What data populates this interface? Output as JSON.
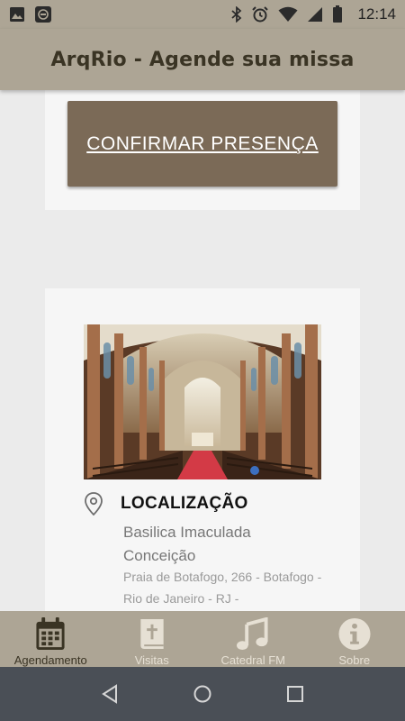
{
  "status_bar": {
    "time": "12:14",
    "icons": [
      "image-icon",
      "notification-app-icon",
      "bluetooth-icon",
      "alarm-icon",
      "wifi-icon",
      "signal-icon",
      "battery-icon"
    ]
  },
  "app_bar": {
    "title": "ArqRio - Agende sua missa"
  },
  "confirm": {
    "label": "CONFIRMAR PRESENÇA"
  },
  "location": {
    "heading": "LOCALIZAÇÃO",
    "name": "Basilica Imaculada Conceição",
    "address": "Praia de Botafogo, 266 - Botafogo - Rio de Janeiro - RJ -"
  },
  "bottom_nav": {
    "items": [
      {
        "label": "Agendamento",
        "icon": "calendar-icon",
        "active": true
      },
      {
        "label": "Visitas",
        "icon": "bible-icon",
        "active": false
      },
      {
        "label": "Catedral FM",
        "icon": "music-note-icon",
        "active": false
      },
      {
        "label": "Sobre",
        "icon": "info-icon",
        "active": false
      }
    ]
  },
  "colors": {
    "bar": "#ada595",
    "button": "#7b6a57",
    "active": "#3a3424",
    "inactive": "#e6e0d4",
    "system_nav": "#4a4f56"
  }
}
